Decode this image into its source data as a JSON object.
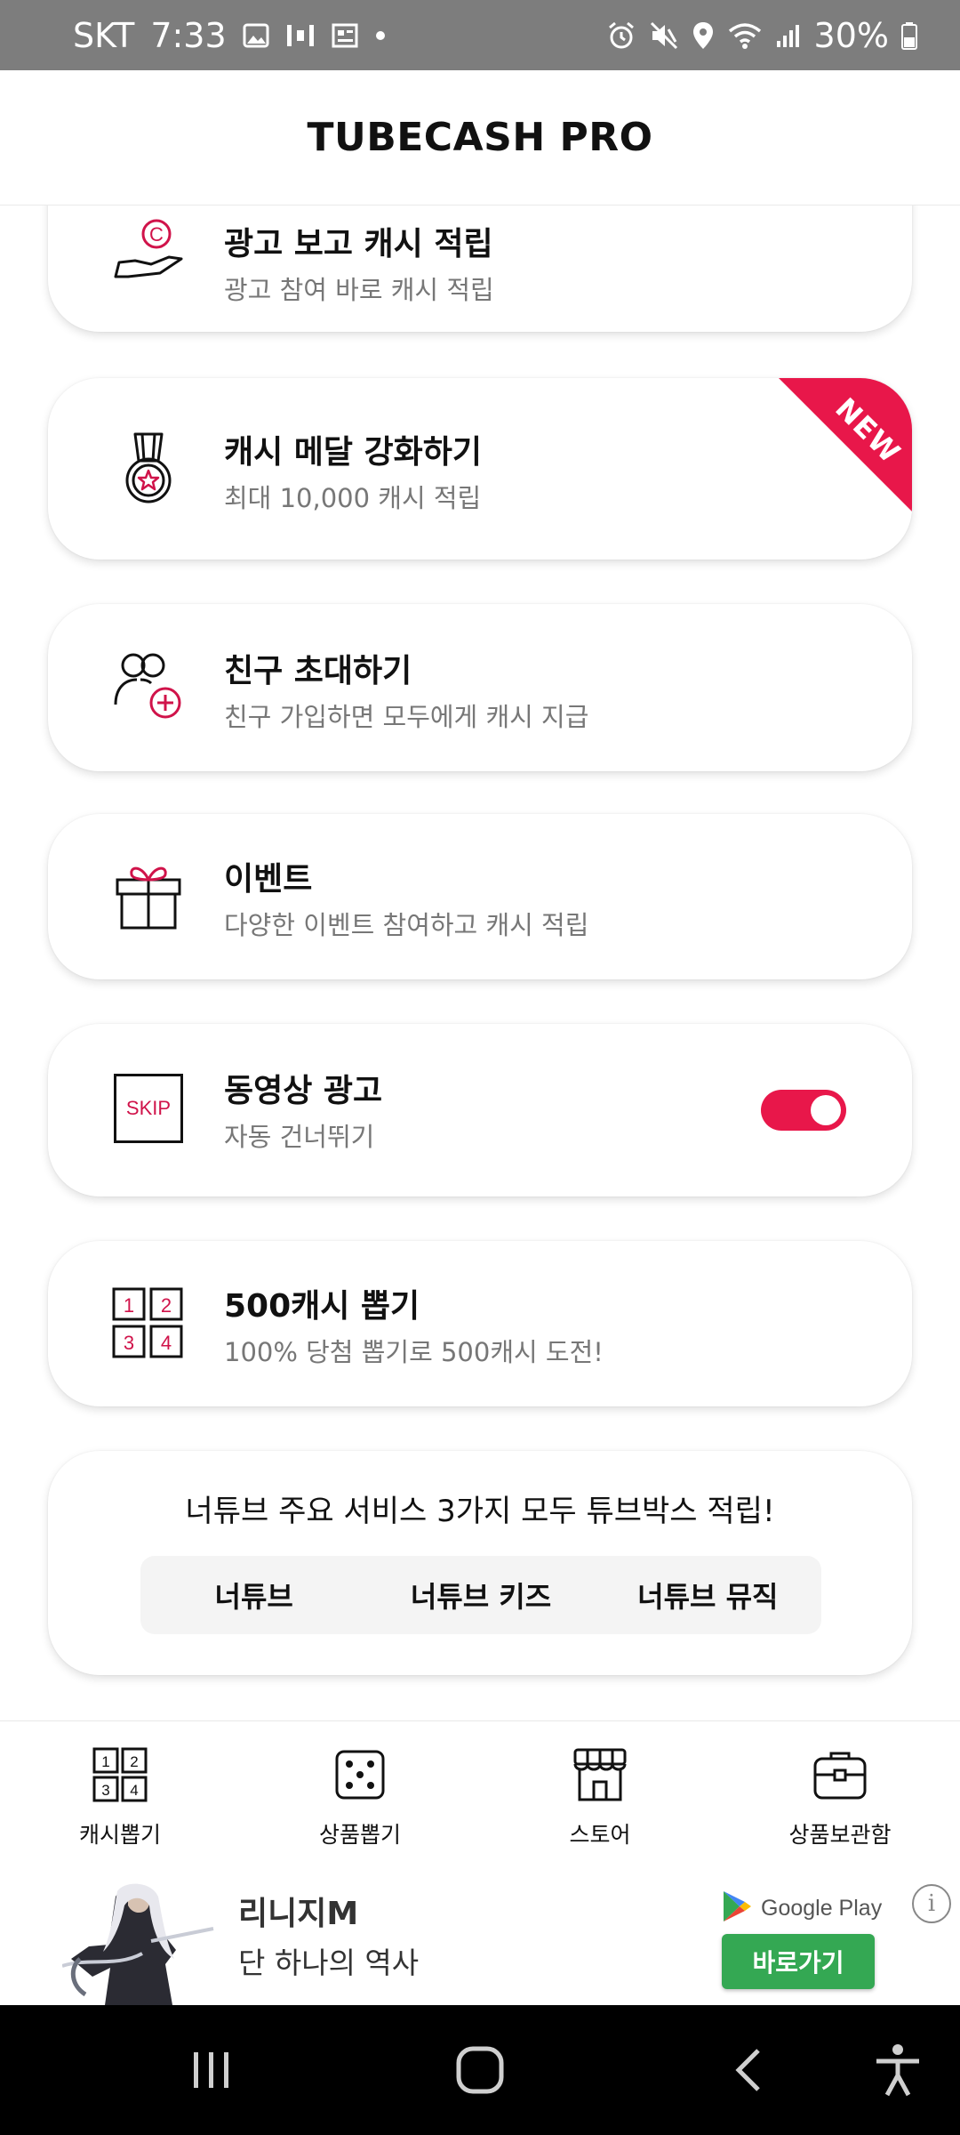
{
  "status_bar": {
    "carrier": "SKT",
    "time": "7:33",
    "battery": "30%"
  },
  "app": {
    "title": "TUBECASH PRO"
  },
  "cards": [
    {
      "title": "광고 보고 캐시 적립",
      "subtitle": "광고 참여 바로 캐시 적립",
      "icon": "hand-coin-icon"
    },
    {
      "title": "캐시 메달 강화하기",
      "subtitle": "최대 10,000 캐시 적립",
      "icon": "medal-icon",
      "badge": "NEW"
    },
    {
      "title": "친구 초대하기",
      "subtitle": "친구 가입하면 모두에게 캐시 지급",
      "icon": "invite-friend-icon"
    },
    {
      "title": "이벤트",
      "subtitle": "다양한 이벤트 참여하고 캐시 적립",
      "icon": "gift-icon"
    },
    {
      "title": "동영상 광고",
      "subtitle": "자동 건너뛰기",
      "icon": "skip-icon",
      "icon_text": "SKIP",
      "toggle_on": true
    },
    {
      "title": "500캐시 뽑기",
      "subtitle": "100% 당첨 뽑기로 500캐시 도전!",
      "icon": "number-grid-icon"
    }
  ],
  "grid_numbers": [
    "1",
    "2",
    "3",
    "4"
  ],
  "services": {
    "title": "너튜브 주요 서비스 3가지 모두 튜브박스 적립!",
    "tabs": [
      "너튜브",
      "너튜브 키즈",
      "너튜브 뮤직"
    ]
  },
  "bottom_nav": [
    {
      "label": "캐시뽑기",
      "icon": "number-grid-icon"
    },
    {
      "label": "상품뽑기",
      "icon": "dice-icon"
    },
    {
      "label": "스토어",
      "icon": "store-icon"
    },
    {
      "label": "상품보관함",
      "icon": "briefcase-icon"
    }
  ],
  "ad": {
    "title": "리니지M",
    "subtitle": "단 하나의 역사",
    "store": "Google Play",
    "cta": "바로가기",
    "info": "i"
  },
  "colors": {
    "accent": "#e8174a",
    "status_bar": "#7d7d7d",
    "ad_button": "#34a853"
  }
}
